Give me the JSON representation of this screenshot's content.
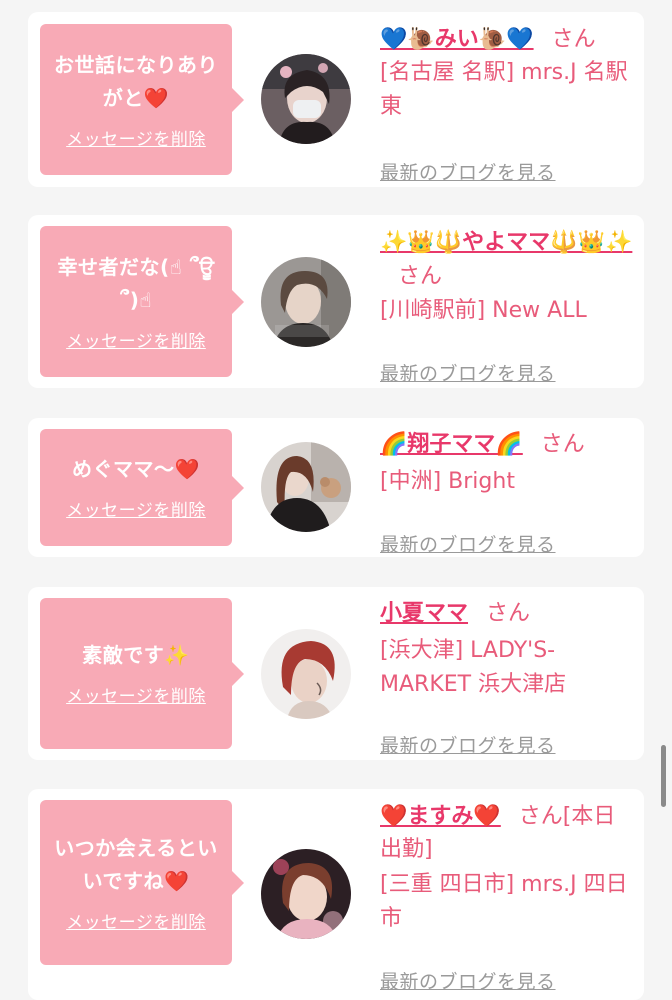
{
  "messages": [
    {
      "message_text": "お世話になりありがと❤️",
      "delete_label": "メッセージを削除",
      "name": "💙🐌みい🐌💙",
      "honorific": "さん",
      "shop": "[名古屋 名駅] mrs.J 名駅東",
      "blog_label": "最新のブログを見る"
    },
    {
      "message_text": "幸せ者だな(☝︎ ՞ਊ ՞)☝︎",
      "delete_label": "メッセージを削除",
      "name": "✨👑🔱やよママ🔱👑✨",
      "honorific": "さん",
      "shop": "[川崎駅前] New ALL",
      "blog_label": "最新のブログを見る"
    },
    {
      "message_text": "めぐママ〜❤️",
      "delete_label": "メッセージを削除",
      "name": "🌈翔子ママ🌈",
      "honorific": "さん",
      "shop": "[中洲] Bright",
      "blog_label": "最新のブログを見る"
    },
    {
      "message_text": "素敵です✨",
      "delete_label": "メッセージを削除",
      "name": "小夏ママ",
      "honorific": "さん",
      "shop": "[浜大津] LADY'S-MARKET 浜大津店",
      "blog_label": "最新のブログを見る"
    },
    {
      "message_text": "いつか会えるといいですね❤️",
      "delete_label": "メッセージを削除",
      "name": "❤️ますみ❤️",
      "honorific": "さん[本日出勤]",
      "shop": "[三重 四日市] mrs.J 四日市",
      "blog_label": "最新のブログを見る"
    }
  ],
  "colors": {
    "bubble": "#f8aab6",
    "name": "#e8386a",
    "text": "#e85b7a",
    "link_gray": "#9a9a9a",
    "background": "#f5f5f5"
  },
  "avatar_icons": [
    "avatar-woman-masked",
    "avatar-woman-short-hair",
    "avatar-woman-long-hair",
    "avatar-woman-red-hair",
    "avatar-woman-bright"
  ]
}
